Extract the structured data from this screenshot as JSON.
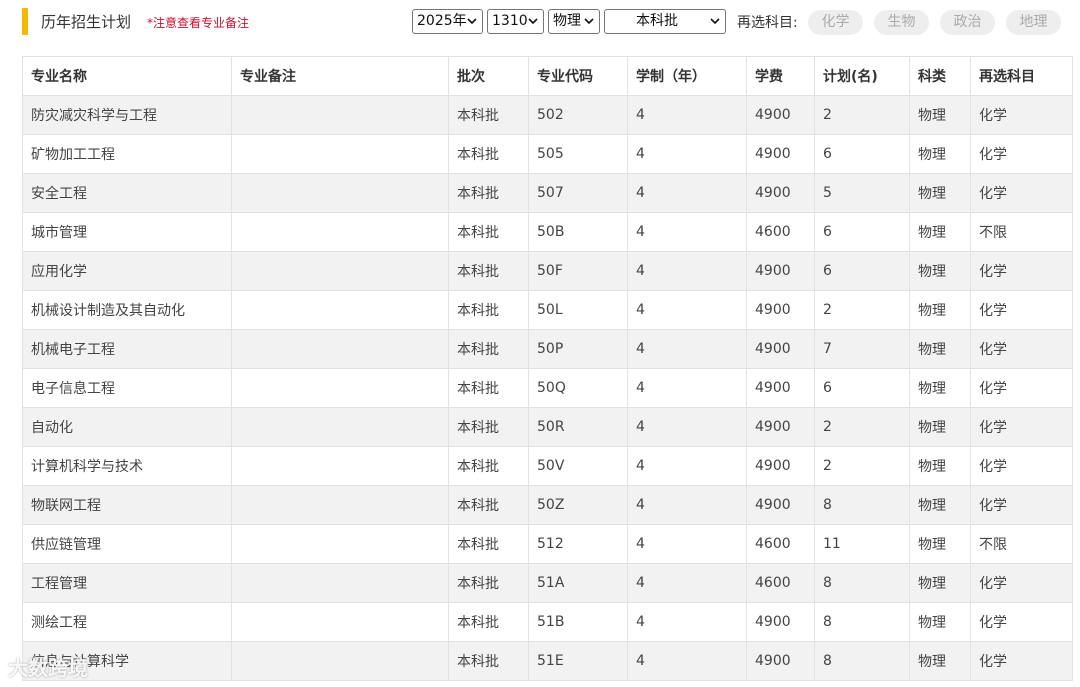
{
  "header": {
    "title": "历年招生计划",
    "note": "*注意查看专业备注",
    "filters": {
      "year": "2025年",
      "code": "1310",
      "subject": "物理",
      "batch": "本科批"
    },
    "reselect_label": "再选科目:",
    "reselect_options": [
      "化学",
      "生物",
      "政治",
      "地理"
    ]
  },
  "table": {
    "columns": [
      "专业名称",
      "专业备注",
      "批次",
      "专业代码",
      "学制（年）",
      "学费",
      "计划(名)",
      "科类",
      "再选科目"
    ],
    "rows": [
      [
        "防灾减灾科学与工程",
        "",
        "本科批",
        "502",
        "4",
        "4900",
        "2",
        "物理",
        "化学"
      ],
      [
        "矿物加工工程",
        "",
        "本科批",
        "505",
        "4",
        "4900",
        "6",
        "物理",
        "化学"
      ],
      [
        "安全工程",
        "",
        "本科批",
        "507",
        "4",
        "4900",
        "5",
        "物理",
        "化学"
      ],
      [
        "城市管理",
        "",
        "本科批",
        "50B",
        "4",
        "4600",
        "6",
        "物理",
        "不限"
      ],
      [
        "应用化学",
        "",
        "本科批",
        "50F",
        "4",
        "4900",
        "6",
        "物理",
        "化学"
      ],
      [
        "机械设计制造及其自动化",
        "",
        "本科批",
        "50L",
        "4",
        "4900",
        "2",
        "物理",
        "化学"
      ],
      [
        "机械电子工程",
        "",
        "本科批",
        "50P",
        "4",
        "4900",
        "7",
        "物理",
        "化学"
      ],
      [
        "电子信息工程",
        "",
        "本科批",
        "50Q",
        "4",
        "4900",
        "6",
        "物理",
        "化学"
      ],
      [
        "自动化",
        "",
        "本科批",
        "50R",
        "4",
        "4900",
        "2",
        "物理",
        "化学"
      ],
      [
        "计算机科学与技术",
        "",
        "本科批",
        "50V",
        "4",
        "4900",
        "2",
        "物理",
        "化学"
      ],
      [
        "物联网工程",
        "",
        "本科批",
        "50Z",
        "4",
        "4900",
        "8",
        "物理",
        "化学"
      ],
      [
        "供应链管理",
        "",
        "本科批",
        "512",
        "4",
        "4600",
        "11",
        "物理",
        "不限"
      ],
      [
        "工程管理",
        "",
        "本科批",
        "51A",
        "4",
        "4600",
        "8",
        "物理",
        "化学"
      ],
      [
        "测绘工程",
        "",
        "本科批",
        "51B",
        "4",
        "4900",
        "8",
        "物理",
        "化学"
      ],
      [
        "信息与计算科学",
        "",
        "本科批",
        "51E",
        "4",
        "4900",
        "8",
        "物理",
        "化学"
      ]
    ]
  },
  "watermark": "大数跨境"
}
